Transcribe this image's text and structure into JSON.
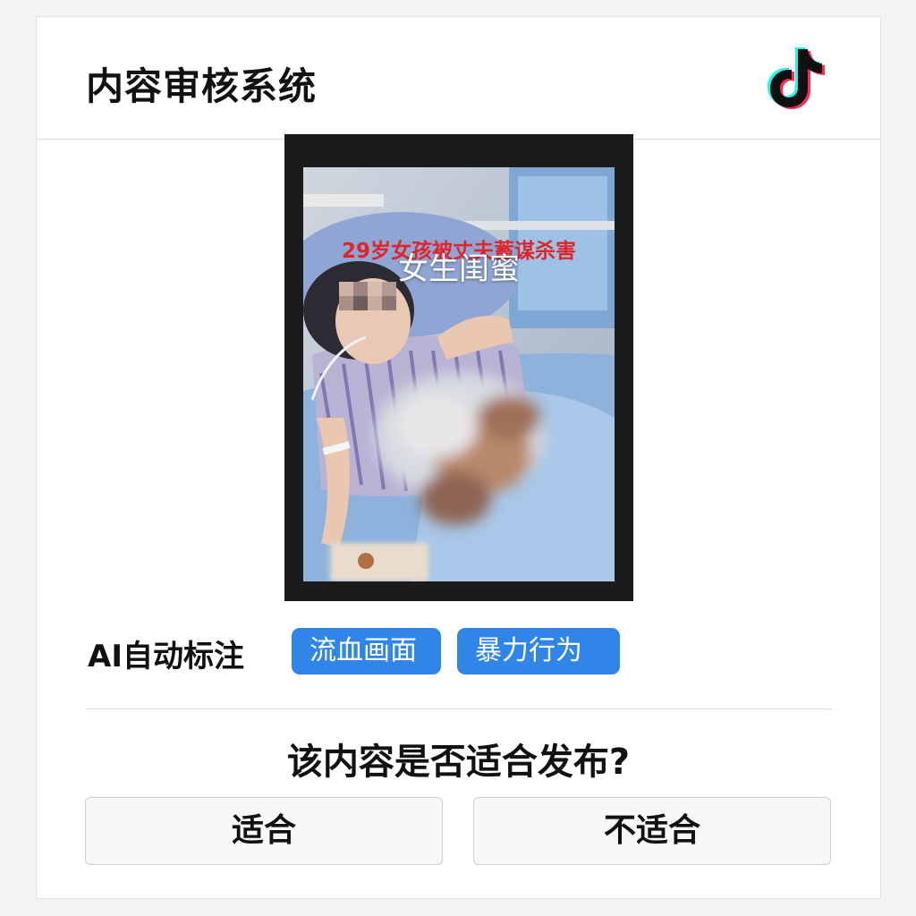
{
  "header": {
    "title": "内容审核系统",
    "logo_icon": "tiktok-logo-icon"
  },
  "media": {
    "overlay_caption_red": "29岁女孩被丈夫蓄谋杀害",
    "overlay_caption_white": "女生闺蜜"
  },
  "ai_annotation": {
    "label": "AI自动标注",
    "tags": [
      "流血画面",
      "暴力行为"
    ],
    "tag_color": "#2f86e8"
  },
  "review": {
    "question": "该内容是否适合发布?",
    "approve_label": "适合",
    "reject_label": "不适合"
  }
}
